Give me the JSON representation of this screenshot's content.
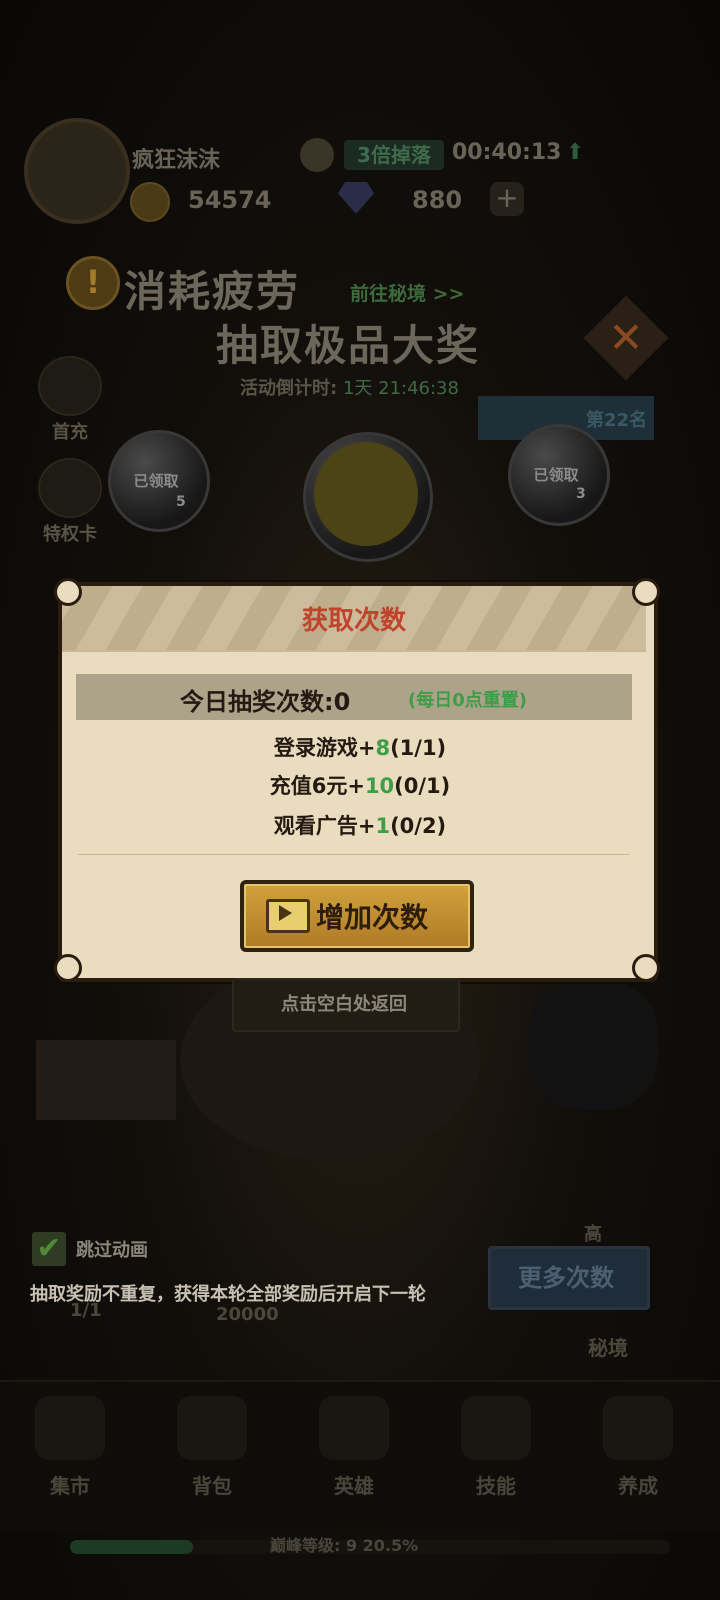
{
  "header": {
    "player_name": "疯狂沫沫",
    "coins": "54574",
    "gems": "880",
    "plus": "+",
    "drop_badge": "3倍掉落",
    "timer": "00:40:13"
  },
  "event_banner": {
    "line1": "消耗疲劳",
    "line2": "抽取极品大奖",
    "link": "前往秘境 >>",
    "countdown_label": "活动倒计时:",
    "countdown_value": "1天 21:46:38"
  },
  "side_menu": [
    {
      "label": "首充",
      "icon": "gift-icon"
    },
    {
      "label": "特权卡",
      "icon": "card-icon"
    }
  ],
  "rank_text": "第22名",
  "bubbles": [
    {
      "label": "已领取",
      "count": "5",
      "icon": "pickaxe-icon"
    },
    {
      "label": "已领取",
      "count": "3",
      "icon": "hammer-icon"
    }
  ],
  "dialog": {
    "title": "获取次数",
    "today_count_label": "今日抽奖次数:0",
    "reset_note": "(每日0点重置)",
    "rows": [
      {
        "prefix": "登录游戏+",
        "value": "8",
        "progress": "(1/1)"
      },
      {
        "prefix": "充值6元+",
        "value": "10",
        "progress": "(0/1)"
      },
      {
        "prefix": "观看广告+",
        "value": "1",
        "progress": "(0/2)"
      }
    ],
    "add_button": "增加次数",
    "back_hint": "点击空白处返回"
  },
  "bottom": {
    "skip_label": "跳过动画",
    "rule_text": "抽取奖励不重复，获得本轮全部奖励后开启下一轮",
    "more_button": "更多次数",
    "progress_small": "1/1",
    "score": "20000",
    "high_label": "高",
    "secret_label": "秘境"
  },
  "tabs": [
    {
      "label": "集市",
      "icon": "scale-icon"
    },
    {
      "label": "背包",
      "icon": "backpack-icon"
    },
    {
      "label": "英雄",
      "icon": "helmet-icon"
    },
    {
      "label": "技能",
      "icon": "flame-icon"
    },
    {
      "label": "养成",
      "icon": "diamond-grid-icon"
    }
  ],
  "level": {
    "text": "巅峰等级: 9   20.5%",
    "progress_percent": 20.5
  },
  "colors": {
    "accent_green": "#3f9d48",
    "title_red": "#c0432c",
    "button_gold": "#d2a23c"
  }
}
